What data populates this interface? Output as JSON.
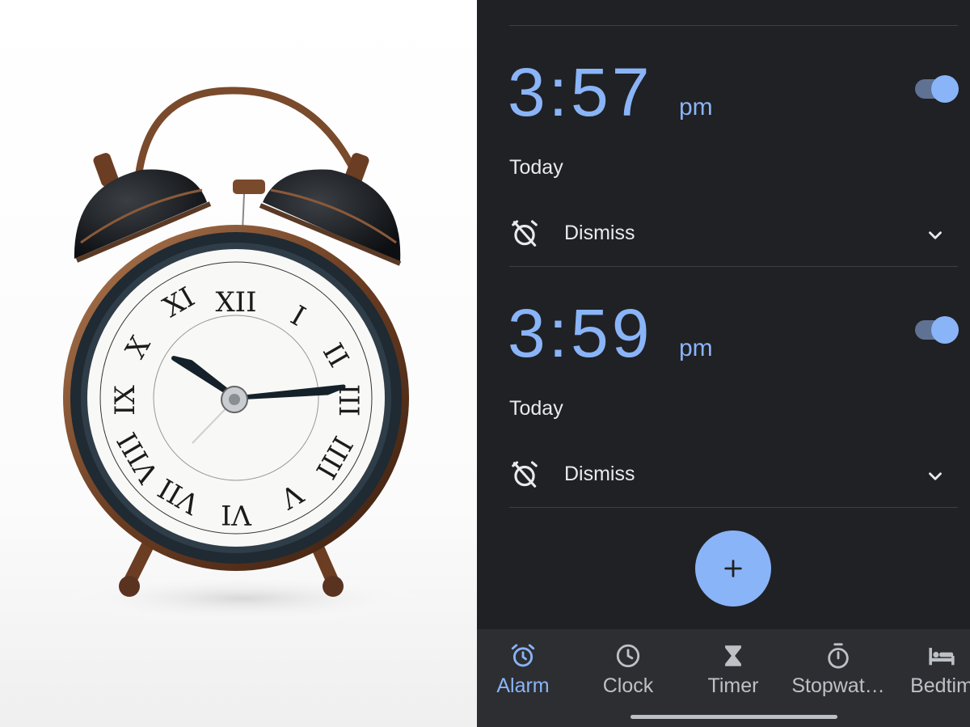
{
  "colors": {
    "background": "#202124",
    "accent": "#8ab4f8",
    "text": "#e8eaed",
    "nav_background": "#2d2e31",
    "toggle_track": "#5f7294"
  },
  "photo": {
    "icon": "alarm-clock-photo"
  },
  "alarms": [
    {
      "time": "3:57",
      "period": "pm",
      "enabled": true,
      "day": "Today",
      "dismiss_label": "Dismiss",
      "dismiss_icon": "alarm-off-icon",
      "expand_icon": "chevron-down-icon"
    },
    {
      "time": "3:59",
      "period": "pm",
      "enabled": true,
      "day": "Today",
      "dismiss_label": "Dismiss",
      "dismiss_icon": "alarm-off-icon",
      "expand_icon": "chevron-down-icon"
    }
  ],
  "fab": {
    "icon": "plus-icon"
  },
  "nav": {
    "items": [
      {
        "label": "Alarm",
        "icon": "alarm-icon",
        "active": true
      },
      {
        "label": "Clock",
        "icon": "clock-icon",
        "active": false
      },
      {
        "label": "Timer",
        "icon": "hourglass-icon",
        "active": false
      },
      {
        "label": "Stopwat…",
        "icon": "stopwatch-icon",
        "active": false
      },
      {
        "label": "Bedtim",
        "icon": "bed-icon",
        "active": false
      }
    ]
  }
}
